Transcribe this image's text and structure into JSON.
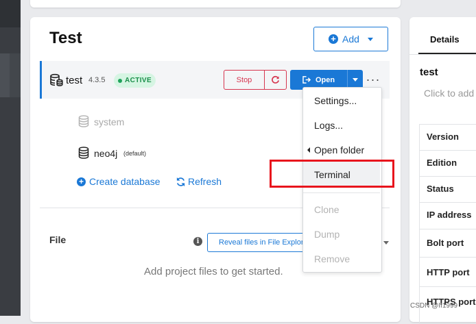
{
  "project": {
    "title": "Test",
    "add_label": "Add"
  },
  "dbms": {
    "name": "test",
    "version": "4.3.5",
    "status": "ACTIVE",
    "stop_label": "Stop",
    "open_label": "Open",
    "databases": [
      {
        "name": "system",
        "tag": ""
      },
      {
        "name": "neo4j",
        "tag": "(default)"
      }
    ],
    "create_db_label": "Create database",
    "refresh_label": "Refresh"
  },
  "files": {
    "label": "File",
    "reveal_label": "Reveal files in File Explorer",
    "empty_message": "Add project files to get started."
  },
  "menu": {
    "items": [
      {
        "label": "Settings...",
        "enabled": true
      },
      {
        "label": "Logs...",
        "enabled": true
      },
      {
        "label": "Open folder",
        "enabled": true
      },
      {
        "label": "Terminal",
        "enabled": true
      },
      {
        "label": "Clone",
        "enabled": false
      },
      {
        "label": "Dump",
        "enabled": false
      },
      {
        "label": "Remove",
        "enabled": false
      }
    ]
  },
  "side_panel": {
    "tab": "Details",
    "name": "test",
    "description_placeholder": "Click to add",
    "properties": [
      "Version",
      "Edition",
      "Status",
      "IP address",
      "Bolt port",
      "HTTP port",
      "HTTPS port"
    ]
  },
  "watermark": "CSDN @II1999",
  "colors": {
    "accent": "#1a78d6",
    "danger": "#d6344e",
    "active_badge_bg": "#d6f5e3",
    "active_badge_text": "#1a8f4a",
    "annotation_box": "#e8131c"
  },
  "icons": {
    "add": "plus-circle-icon",
    "dbms": "database-stack-icon",
    "restart": "restart-icon",
    "open": "open-external-icon",
    "more": "more-dots-icon",
    "database": "database-icon",
    "refresh": "refresh-icon",
    "info": "info-icon"
  }
}
